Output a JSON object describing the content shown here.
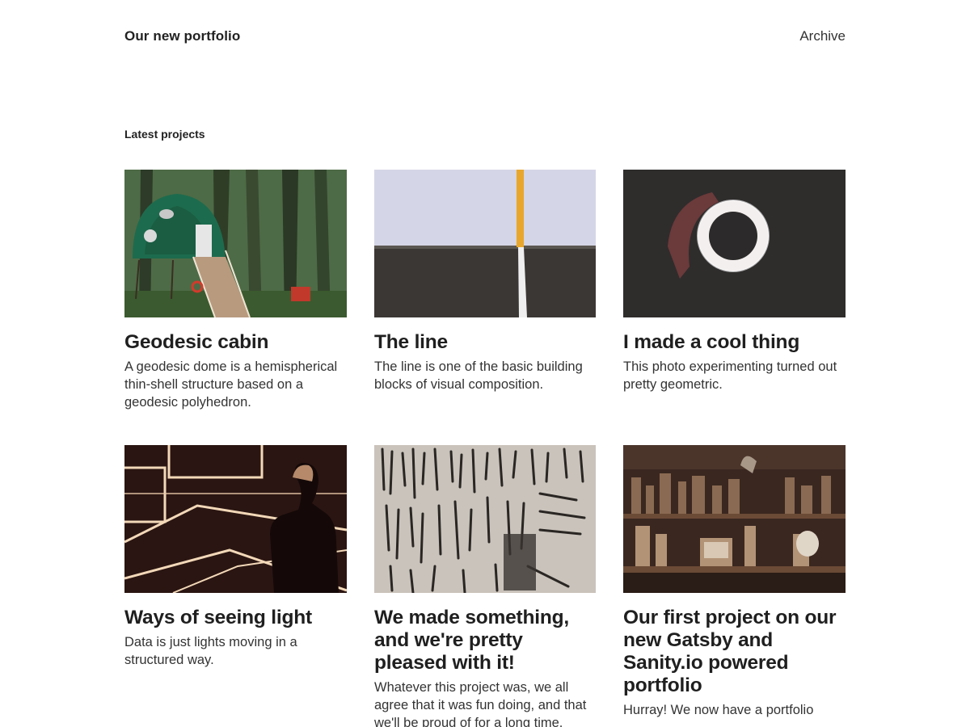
{
  "header": {
    "site_title": "Our new portfolio",
    "nav": [
      {
        "label": "Archive"
      }
    ]
  },
  "main": {
    "section_title": "Latest projects",
    "projects": [
      {
        "title": "Geodesic cabin",
        "description": "A geodesic dome is a hemispherical thin-shell structure based on a geodesic polyhedron.",
        "image_icon": "geodesic-dome-cabin-photo"
      },
      {
        "title": "The line",
        "description": "The line is one of the basic building blocks of visual composition.",
        "image_icon": "road-line-photo"
      },
      {
        "title": "I made a cool thing",
        "description": "This photo experimenting turned out pretty geometric.",
        "image_icon": "light-ring-photo"
      },
      {
        "title": "Ways of seeing light",
        "description": "Data is just lights moving in a structured way.",
        "image_icon": "neon-light-installation-photo"
      },
      {
        "title": "We made something, and we're pretty pleased with it!",
        "description": "Whatever this project was, we all agree that it was fun doing, and that we'll be proud of for a long time.",
        "image_icon": "tool-wall-photo"
      },
      {
        "title": "Our first project on our new Gatsby and Sanity.io powered portfolio",
        "description": "Hurray! We now have a portfolio",
        "image_icon": "workshop-shelves-photo"
      }
    ]
  },
  "colors": {
    "text": "#222222",
    "background": "#ffffff"
  }
}
